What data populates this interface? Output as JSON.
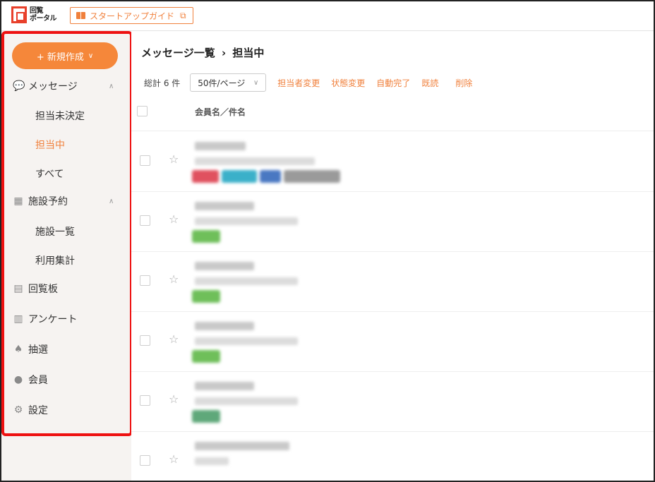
{
  "header": {
    "logo_text_line1": "回覧",
    "logo_text_line2": "ポータル",
    "guide_button": "スタートアップガイド",
    "guide_icon": "external-link-icon"
  },
  "sidebar": {
    "new_button": "+ 新規作成",
    "messages": {
      "label": "メッセージ",
      "icon": "chat-bubbles-icon",
      "children": [
        "担当未決定",
        "担当中",
        "すべて"
      ],
      "active_child": "担当中"
    },
    "facility": {
      "label": "施設予約",
      "icon": "calendar-icon",
      "children": [
        "施設一覧",
        "利用集計"
      ]
    },
    "items": [
      {
        "label": "回覧板",
        "icon": "board-icon"
      },
      {
        "label": "アンケート",
        "icon": "clipboard-icon"
      },
      {
        "label": "抽選",
        "icon": "trophy-icon"
      },
      {
        "label": "会員",
        "icon": "users-icon"
      },
      {
        "label": "設定",
        "icon": "gear-icon"
      }
    ]
  },
  "main": {
    "breadcrumb_parent": "メッセージ一覧",
    "breadcrumb_sep": "›",
    "breadcrumb_current": "担当中",
    "total": "総計 6 件",
    "per_page": "50件/ページ",
    "actions": [
      "担当者変更",
      "状態変更",
      "自動完了",
      "既読",
      "削除"
    ],
    "column_header": "会員名／件名"
  },
  "colors": {
    "accent": "#f5873a",
    "highlight_border": "#ee1111",
    "sidebar_bg": "#f6f3f1"
  }
}
